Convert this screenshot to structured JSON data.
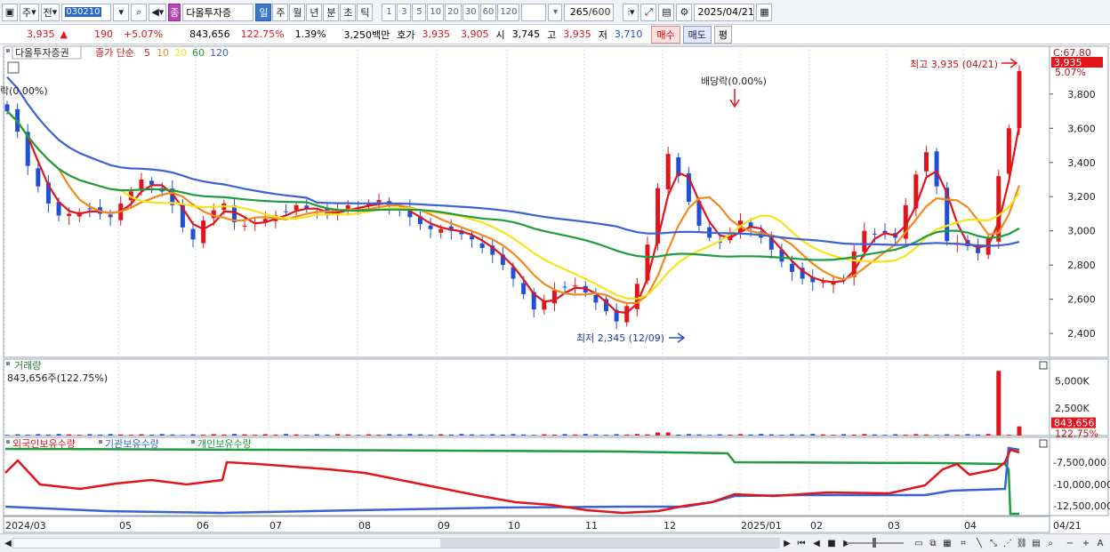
{
  "toolbar": {
    "period_label": "주",
    "prev_label": "전",
    "stock_code": "030210",
    "stock_name": "다올투자증",
    "badge_label": "종",
    "period_buttons": [
      "일",
      "주",
      "월",
      "년",
      "분",
      "초",
      "틱"
    ],
    "interval_buttons": [
      "1",
      "3",
      "5",
      "10",
      "20",
      "30",
      "60",
      "120"
    ],
    "count_value": "265",
    "count_total": "/600",
    "date_value": "2025/04/21"
  },
  "info": {
    "price": "3,935",
    "change": "190",
    "change_pct": "+5.07%",
    "volume": "843,656",
    "volume_pct": "122.75%",
    "turnover_pct": "1.39%",
    "amount": "3,250백만",
    "quote_label": "호가",
    "ask": "3,935",
    "bid": "3,905",
    "open_label": "시",
    "open": "3,745",
    "high_label": "고",
    "high": "3,935",
    "low_label": "저",
    "low": "3,710",
    "buy_label": "매수",
    "sell_label": "매도",
    "eval_label": "평"
  },
  "chart_data": {
    "type": "candlestick",
    "legend": {
      "title": "다올투자증권",
      "indicator": "종가 단순",
      "ma_periods": [
        "5",
        "10",
        "20",
        "60",
        "120"
      ],
      "ma_colors": [
        "#e0151b",
        "#f08a1c",
        "#f7e21a",
        "#1f9a3c",
        "#3a62d6"
      ]
    },
    "y_ticks": [
      "3,800",
      "3,600",
      "3,400",
      "3,200",
      "3,000",
      "2,800",
      "2,600",
      "2,400"
    ],
    "ylim": [
      2260,
      4080
    ],
    "x_ticks": [
      "2024/03",
      "05",
      "06",
      "07",
      "08",
      "09",
      "10",
      "11",
      "12",
      "2025/01",
      "02",
      "03",
      "04"
    ],
    "last_date_label": "04/21",
    "corner_label": "C:67.80",
    "last_price_tag": "3,935",
    "last_pct_tag": "5.07%",
    "annotations": {
      "high": "최고 3,935 (04/21)",
      "low": "최저 2,345 (12/09)",
      "dividend": "배당락(0.00%)",
      "dividend_left": "락(0.00%)"
    },
    "volume_panel": {
      "title": "거래량",
      "value_label": "843,656주(122.75%)",
      "y_ticks": [
        "5,000K",
        "2,500K"
      ],
      "last_tag": "843,656",
      "last_pct_tag": "122.75%"
    },
    "holdings_panel": {
      "series": [
        {
          "name": "외국인보유수량",
          "color": "#e0151b"
        },
        {
          "name": "기관보유수량",
          "color": "#3a62d6"
        },
        {
          "name": "개인보유수량",
          "color": "#1f9a3c"
        }
      ],
      "y_ticks": [
        "-7,500,000",
        "-10,000,000",
        "-12,500,000"
      ]
    },
    "closes": [
      3700,
      3580,
      3380,
      3260,
      3160,
      3090,
      3100,
      3110,
      3130,
      3100,
      3080,
      3160,
      3230,
      3300,
      3270,
      3230,
      3150,
      3020,
      2950,
      3060,
      3120,
      3160,
      3050,
      3030,
      3050,
      3070,
      3090,
      3110,
      3150,
      3130,
      3110,
      3090,
      3120,
      3150,
      3130,
      3160,
      3180,
      3150,
      3120,
      3080,
      3040,
      3010,
      3010,
      3000,
      2980,
      2950,
      2900,
      2860,
      2800,
      2720,
      2630,
      2540,
      2590,
      2650,
      2670,
      2680,
      2640,
      2580,
      2530,
      2470,
      2560,
      2690,
      2920,
      3250,
      3450,
      3320,
      3170,
      3030,
      2960,
      2930,
      2990,
      3060,
      3020,
      2960,
      2890,
      2820,
      2760,
      2720,
      2700,
      2700,
      2700,
      2720,
      2880,
      3000,
      2980,
      2980,
      2960,
      3150,
      3330,
      3460,
      3260,
      2940,
      2930,
      2910,
      2870,
      2960,
      3320,
      3600,
      3935
    ]
  },
  "bottom": {
    "scroll_left": "◀",
    "scroll_right": "▶",
    "nav_buttons": [
      "⏮",
      "◀",
      "■",
      "▶"
    ],
    "zoom_minus": "−",
    "zoom_plus": "+",
    "font_label": "A"
  }
}
